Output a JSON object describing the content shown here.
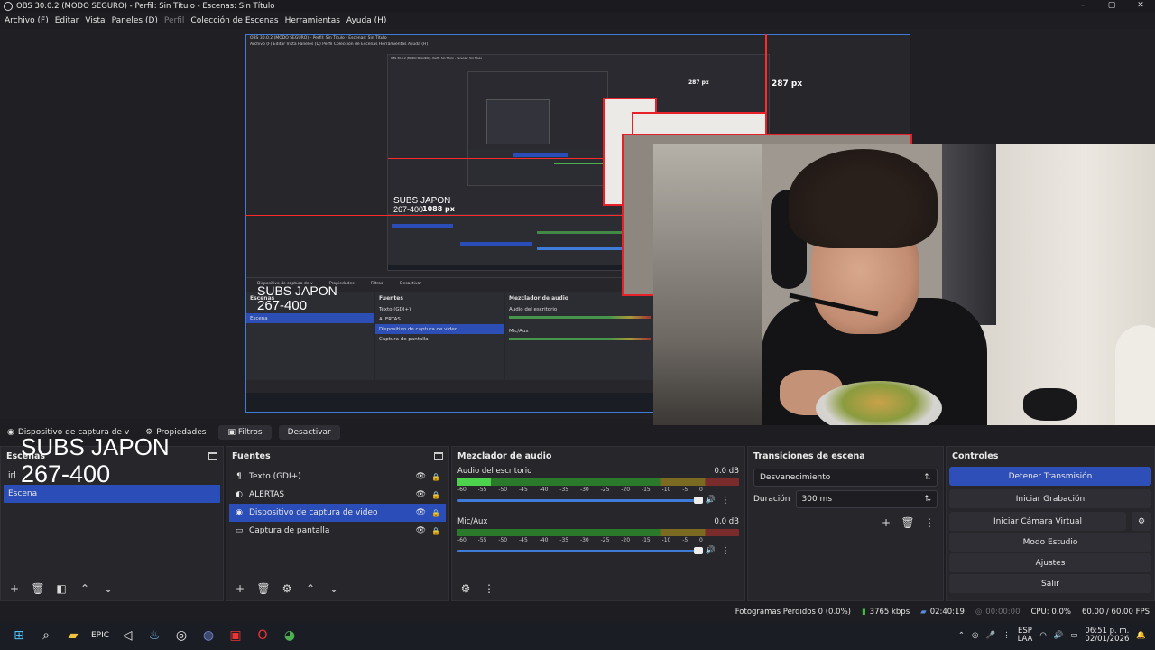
{
  "window": {
    "title": "OBS 30.0.2 (MODO SEGURO) - Perfil: Sin Título - Escenas: Sin Título",
    "controls": [
      "–",
      "▢",
      "✕"
    ]
  },
  "menu": [
    {
      "label": "Archivo (F)",
      "enabled": true
    },
    {
      "label": "Editar",
      "enabled": true
    },
    {
      "label": "Vista",
      "enabled": true
    },
    {
      "label": "Paneles (D)",
      "enabled": true
    },
    {
      "label": "Perfil",
      "enabled": false
    },
    {
      "label": "Colección de Escenas",
      "enabled": true
    },
    {
      "label": "Herramientas",
      "enabled": true
    },
    {
      "label": "Ayuda (H)",
      "enabled": true
    }
  ],
  "preview": {
    "nested_title": "OBS 30.0.2 (MODO SEGURO) - Perfil: Sin Título - Escenas: Sin Título",
    "nested_menu": "Archivo (F)   Editar   Vista   Paneles (D)   Perfil   Colección de Escenas   Herramientas   Ayuda (H)",
    "px_label_1": "287 px",
    "px_label_2": "287 px",
    "px_label_3": "1088 px",
    "subs_line1": "SUBS JAPON",
    "subs_line2": "267-400",
    "nested_source_label": "Dispositivo de captura de v",
    "nested_props": "Propiedades",
    "nested_filters": "Filtros",
    "nested_deactivate": "Desactivar",
    "nested_scenes_header": "Escenas",
    "nested_sources_header": "Fuentes",
    "nested_mixer_header": "Mezclador de audio",
    "nested_scene_item": "Escena",
    "nested_sources": [
      "Texto (GDI+)",
      "ALERTAS",
      "Dispositivo de captura de video",
      "Captura de pantalla"
    ],
    "nested_desktop_audio": "Audio del escritorio",
    "nested_mic": "Mic/Aux"
  },
  "source_toolbar": {
    "source_name": "Dispositivo de captura de v",
    "properties": "Propiedades",
    "filters": "Filtros",
    "deactivate": "Desactivar"
  },
  "scenes": {
    "header": "Escenas",
    "overlay_line1": "SUBS JAPON",
    "overlay_line2": "267-400",
    "items": [
      {
        "label": "irl",
        "selected": false
      },
      {
        "label": "Escena",
        "selected": true
      }
    ]
  },
  "sources": {
    "header": "Fuentes",
    "items": [
      {
        "label": "Texto (GDI+)",
        "icon": "text-icon",
        "selected": false
      },
      {
        "label": "ALERTAS",
        "icon": "browser-icon",
        "selected": false
      },
      {
        "label": "Dispositivo de captura de video",
        "icon": "camera-icon",
        "selected": true
      },
      {
        "label": "Captura de pantalla",
        "icon": "monitor-icon",
        "selected": false
      }
    ]
  },
  "mixer": {
    "header": "Mezclador de audio",
    "ticks": [
      "-60",
      "-55",
      "-50",
      "-45",
      "-40",
      "-35",
      "-30",
      "-25",
      "-20",
      "-15",
      "-10",
      "-5",
      "0"
    ],
    "channels": [
      {
        "name": "Audio del escritorio",
        "db": "0.0 dB",
        "level": 0.12
      },
      {
        "name": "Mic/Aux",
        "db": "0.0 dB",
        "level": 0.0
      }
    ]
  },
  "transitions": {
    "header": "Transiciones de escena",
    "selected": "Desvanecimiento",
    "duration_label": "Duración",
    "duration_value": "300 ms"
  },
  "controls": {
    "header": "Controles",
    "stop_stream": "Detener Transmisión",
    "start_recording": "Iniciar Grabación",
    "start_virtual_cam": "Iniciar Cámara Virtual",
    "studio_mode": "Modo Estudio",
    "settings": "Ajustes",
    "exit": "Salir"
  },
  "status": {
    "dropped_frames": "Fotogramas Perdidos 0 (0.0%)",
    "bitrate": "3765 kbps",
    "stream_time": "02:40:19",
    "rec_time": "00:00:00",
    "cpu": "CPU: 0.0%",
    "fps": "60.00 / 60.00 FPS"
  },
  "taskbar": {
    "lang_line1": "ESP",
    "lang_line2": "LAA",
    "time": "06:51 p. m.",
    "date": "02/01/2026"
  },
  "colors": {
    "accent": "#2b4db8",
    "preview_border": "#3f7bd9",
    "bounding_red": "#e8202a",
    "bitrate_green": "#3fbf3f"
  }
}
